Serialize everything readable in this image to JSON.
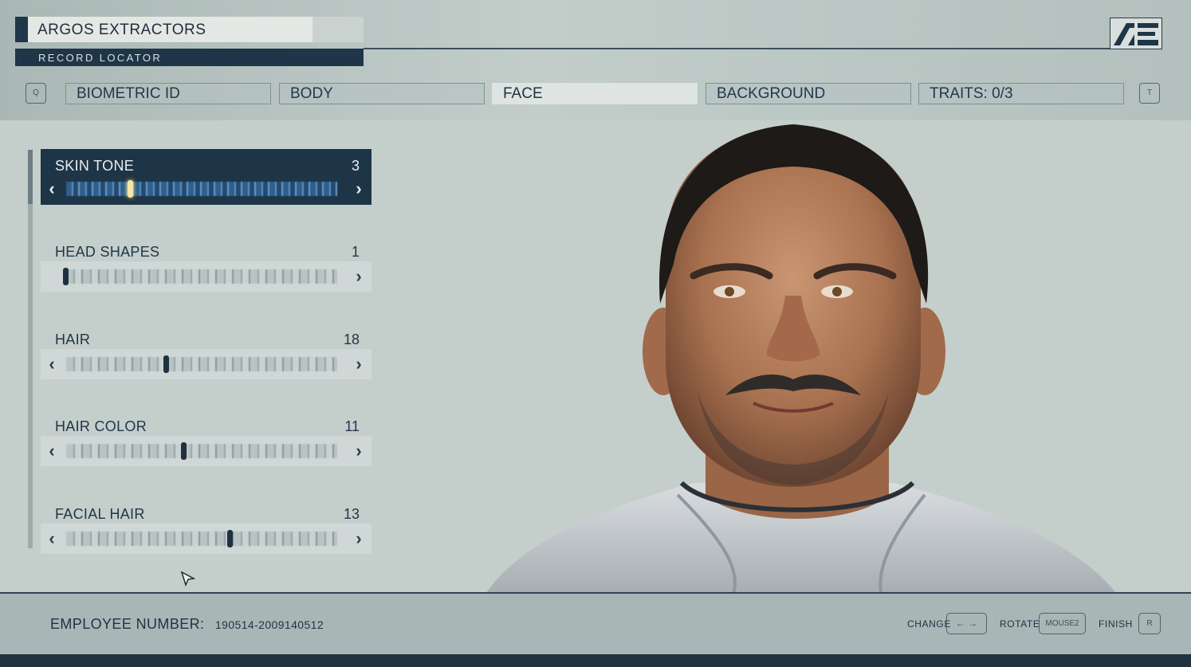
{
  "header": {
    "corporation": "ARGOS EXTRACTORS",
    "subtitle": "RECORD LOCATOR",
    "logo_icon": "ae-logo-icon",
    "prev_key": "Q",
    "next_key": "T"
  },
  "tabs": [
    {
      "label": "BIOMETRIC ID",
      "active": false
    },
    {
      "label": "BODY",
      "active": false
    },
    {
      "label": "FACE",
      "active": true
    },
    {
      "label": "BACKGROUND",
      "active": false
    },
    {
      "label": "TRAITS: 0/3",
      "active": false
    }
  ],
  "sliders": [
    {
      "label": "SKIN TONE",
      "value": "3",
      "selected": true
    },
    {
      "label": "HEAD SHAPES",
      "value": "1",
      "selected": false
    },
    {
      "label": "HAIR",
      "value": "18",
      "selected": false
    },
    {
      "label": "HAIR COLOR",
      "value": "11",
      "selected": false
    },
    {
      "label": "FACIAL HAIR",
      "value": "13",
      "selected": false
    }
  ],
  "footer": {
    "employee_label": "EMPLOYEE NUMBER:",
    "employee_number": "190514-2009140512",
    "change_label": "CHANGE",
    "change_key": "← →",
    "rotate_label": "ROTATE",
    "rotate_key": "MOUSE2",
    "finish_label": "FINISH",
    "finish_key": "R"
  },
  "colors": {
    "navy": "#1f3548",
    "panel_bg": "#c4cfcb",
    "selected_bar": "#2e5f8d",
    "knob_highlight": "#f4e6a8"
  }
}
